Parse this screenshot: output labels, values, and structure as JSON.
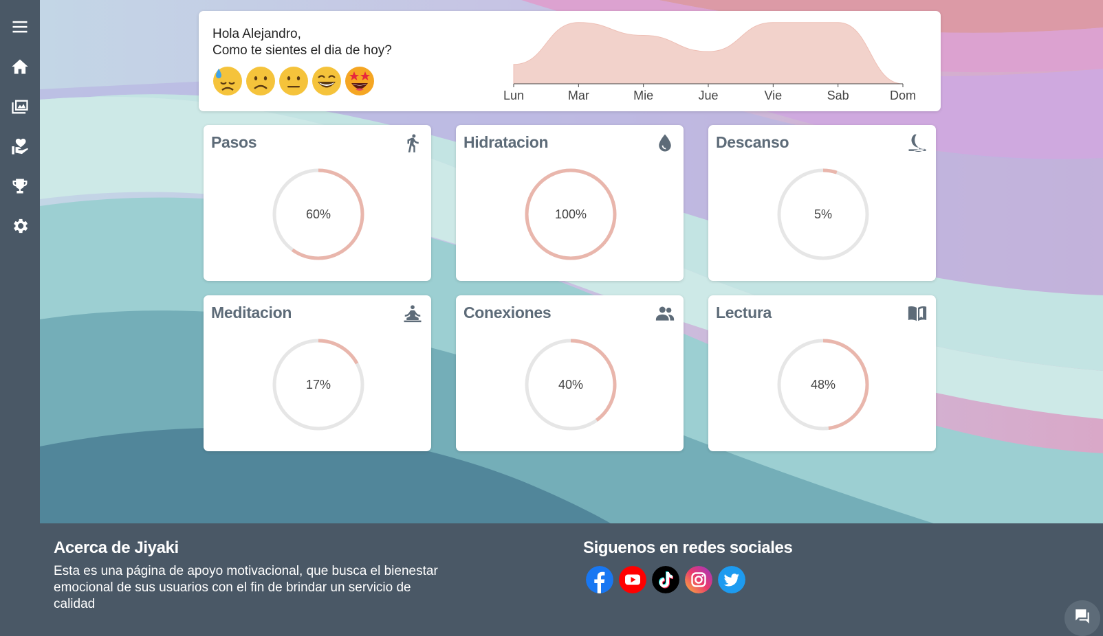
{
  "sidebar": {
    "items": [
      {
        "icon": "menu-icon"
      },
      {
        "icon": "home-icon"
      },
      {
        "icon": "gallery-icon"
      },
      {
        "icon": "care-hand-icon"
      },
      {
        "icon": "trophy-icon"
      },
      {
        "icon": "settings-gear-icon"
      }
    ]
  },
  "greeting": {
    "line1": "Hola Alejandro,",
    "line2": "Como te sientes el dia de hoy?",
    "moods": [
      "sad-sweat-emoji",
      "frowning-emoji",
      "neutral-emoji",
      "grinning-emoji",
      "star-struck-emoji"
    ]
  },
  "chart_data": {
    "type": "area",
    "categories": [
      "Lun",
      "Mar",
      "Mie",
      "Jue",
      "Vie",
      "Sab",
      "Dom"
    ],
    "values": [
      3,
      9.5,
      7.5,
      5,
      9.5,
      9.5,
      0
    ],
    "ylim": [
      0,
      10
    ],
    "grid": false,
    "color": "#f2d2cb"
  },
  "cards": [
    {
      "title": "Pasos",
      "value": 60,
      "label": "60%",
      "icon": "walking-icon"
    },
    {
      "title": "Hidratacion",
      "value": 100,
      "label": "100%",
      "icon": "water-drop-icon"
    },
    {
      "title": "Descanso",
      "value": 5,
      "label": "5%",
      "icon": "moon-icon"
    },
    {
      "title": "Meditacion",
      "value": 17,
      "label": "17%",
      "icon": "meditation-icon"
    },
    {
      "title": "Conexiones",
      "value": 40,
      "label": "40%",
      "icon": "people-icon"
    },
    {
      "title": "Lectura",
      "value": 48,
      "label": "48%",
      "icon": "open-book-icon"
    }
  ],
  "colors": {
    "progress": "#e9b6ac",
    "track": "#e6e6e6",
    "sidebar": "#4a5866",
    "card_title": "#5d6b78"
  },
  "footer": {
    "about_title": "Acerca de Jiyaki",
    "about_text": "Esta es una página de apoyo motivacional, que busca el bienestar emocional de sus usuarios con el fin de brindar un servicio de calidad",
    "social_title": "Siguenos en redes sociales",
    "socials": [
      "facebook-icon",
      "youtube-icon",
      "tiktok-icon",
      "instagram-icon",
      "twitter-icon"
    ]
  }
}
